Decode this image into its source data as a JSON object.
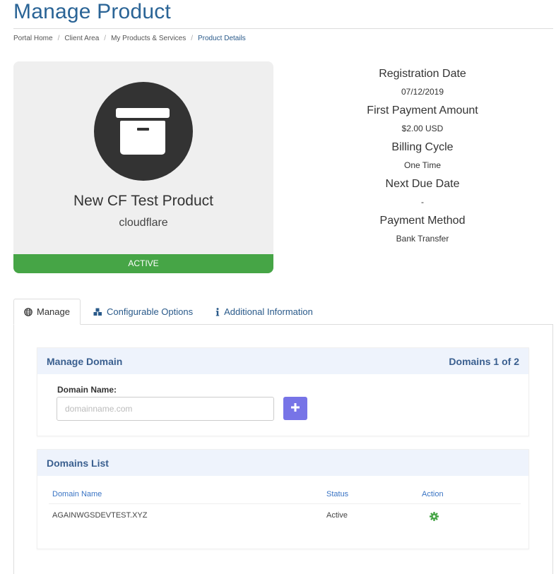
{
  "page": {
    "title": "Manage Product"
  },
  "breadcrumb": {
    "items": [
      "Portal Home",
      "Client Area",
      "My Products & Services",
      "Product Details"
    ],
    "separator": "/"
  },
  "product": {
    "icon": "archive-box-icon",
    "name": "New CF Test Product",
    "group": "cloudflare",
    "status": "Active",
    "status_color": "#46a546"
  },
  "details": [
    {
      "label": "Registration Date",
      "value": "07/12/2019"
    },
    {
      "label": "First Payment Amount",
      "value": "$2.00 USD"
    },
    {
      "label": "Billing Cycle",
      "value": "One Time"
    },
    {
      "label": "Next Due Date",
      "value": "-"
    },
    {
      "label": "Payment Method",
      "value": "Bank Transfer"
    }
  ],
  "tabs": [
    {
      "label": "Manage",
      "icon": "globe-icon",
      "active": true
    },
    {
      "label": "Configurable Options",
      "icon": "cubes-icon",
      "active": false
    },
    {
      "label": "Additional Information",
      "icon": "info-icon",
      "active": false
    }
  ],
  "manage_domain": {
    "heading": "Manage Domain",
    "count_text": "Domains 1 of 2",
    "field_label": "Domain Name:",
    "placeholder": "domainname.com",
    "value": "",
    "add_button_icon": "plus-icon",
    "accent_color": "#7774e7"
  },
  "domains_list": {
    "heading": "Domains List",
    "columns": [
      "Domain Name",
      "Status",
      "Action"
    ],
    "rows": [
      {
        "domain": "AGAINWGSDEVTEST.XYZ",
        "status": "Active",
        "action_icon": "gear-icon"
      }
    ]
  }
}
